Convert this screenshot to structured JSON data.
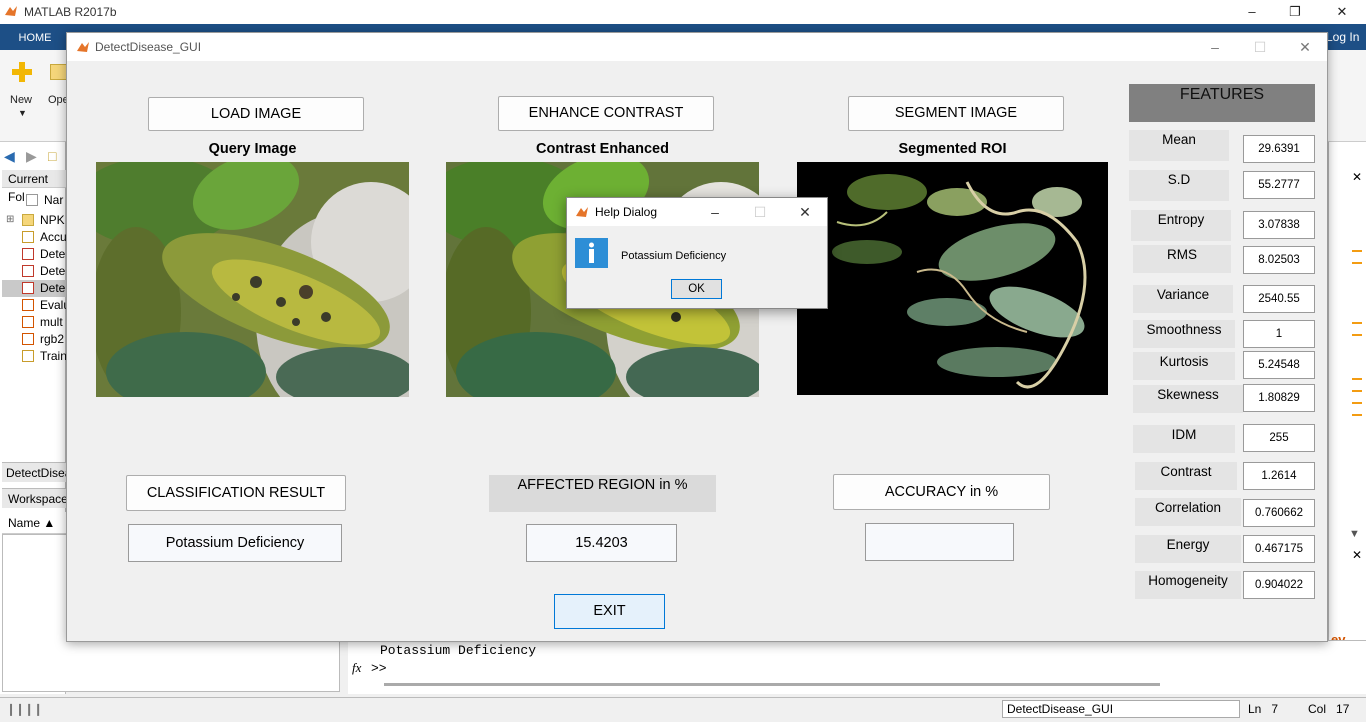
{
  "matlab": {
    "title": "MATLAB R2017b",
    "home_tab": "HOME",
    "login": "Log In",
    "ribbon": {
      "new_label": "New",
      "open_label": "Ope"
    },
    "current_folder_label": "Current Fol",
    "files": [
      {
        "name": "Nar",
        "type": "header"
      },
      {
        "name": "NPK",
        "type": "folder"
      },
      {
        "name": "Accu",
        "type": "table"
      },
      {
        "name": "Dete",
        "type": "mfile"
      },
      {
        "name": "Dete",
        "type": "fig"
      },
      {
        "name": "Dete",
        "type": "fig",
        "selected": true
      },
      {
        "name": "Evalu",
        "type": "mfile"
      },
      {
        "name": "mult",
        "type": "mfile"
      },
      {
        "name": "rgb2",
        "type": "mfile"
      },
      {
        "name": "Train",
        "type": "table"
      }
    ],
    "detect_panel_label": "DetectDisea",
    "workspace_label": "Workspace",
    "name_column": "Name ▲",
    "command_output": "Potassium Deficiency",
    "prompt": ">>",
    "fx_label": "fx",
    "status": {
      "name": "DetectDisease_GUI",
      "ln_label": "Ln",
      "ln_value": "7",
      "col_label": "Col",
      "col_value": "17"
    },
    "right_strip_text": "ev"
  },
  "gui": {
    "title": "DetectDisease_GUI",
    "buttons": {
      "load": "LOAD IMAGE",
      "enhance": "ENHANCE CONTRAST",
      "segment": "SEGMENT IMAGE",
      "classification": "CLASSIFICATION RESULT",
      "accuracy": "ACCURACY in %",
      "exit": "EXIT"
    },
    "panel_titles": {
      "query": "Query Image",
      "enhanced": "Contrast Enhanced",
      "segmented": "Segmented ROI"
    },
    "affected_label": "AFFECTED REGION in %",
    "classification_result": "Potassium Deficiency",
    "affected_value": "15.4203",
    "accuracy_value": "",
    "features_header": "FEATURES",
    "features": [
      {
        "label": "Mean",
        "value": "29.6391"
      },
      {
        "label": "S.D",
        "value": "55.2777"
      },
      {
        "label": "Entropy",
        "value": "3.07838"
      },
      {
        "label": "RMS",
        "value": "8.02503"
      },
      {
        "label": "Variance",
        "value": "2540.55"
      },
      {
        "label": "Smoothness",
        "value": "1"
      },
      {
        "label": "Kurtosis",
        "value": "5.24548"
      },
      {
        "label": "Skewness",
        "value": "1.80829"
      },
      {
        "label": "IDM",
        "value": "255"
      },
      {
        "label": "Contrast",
        "value": "1.2614"
      },
      {
        "label": "Correlation",
        "value": "0.760662"
      },
      {
        "label": "Energy",
        "value": "0.467175"
      },
      {
        "label": "Homogeneity",
        "value": "0.904022"
      }
    ]
  },
  "dialog": {
    "title": "Help Dialog",
    "message": "Potassium Deficiency",
    "ok": "OK",
    "icon": "info-icon"
  },
  "colors": {
    "ribbon_blue": "#1d4f86",
    "features_header": "#808080",
    "info_blue": "#2d8ed6"
  }
}
